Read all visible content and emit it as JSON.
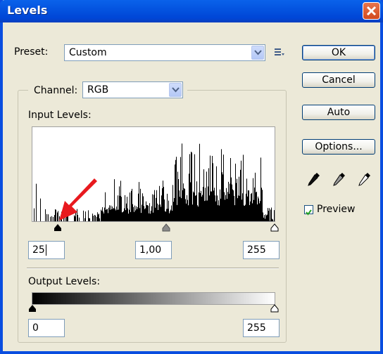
{
  "window": {
    "title": "Levels"
  },
  "preset": {
    "label": "Preset:",
    "value": "Custom"
  },
  "buttons": {
    "ok": "OK",
    "cancel": "Cancel",
    "auto": "Auto",
    "options": "Options..."
  },
  "channel": {
    "label": "Channel:",
    "value": "RGB"
  },
  "input_levels": {
    "label": "Input Levels:",
    "black": "25",
    "gamma": "1,00",
    "white": "255",
    "black_level": 25,
    "white_level": 255
  },
  "output_levels": {
    "label": "Output Levels:",
    "black": "0",
    "white": "255",
    "black_level": 0,
    "white_level": 255
  },
  "preview": {
    "label": "Preview",
    "checked": true
  },
  "icons": [
    "close-icon",
    "options-menu-icon",
    "black-eyedropper-icon",
    "gray-eyedropper-icon",
    "white-eyedropper-icon",
    "checkbox-check-icon",
    "annotation-arrow-icon"
  ],
  "colors": {
    "titlebar": "#0454e0",
    "dialog": "#ece9d8",
    "close": "#d24a1e",
    "arrow": "#e8191e"
  }
}
